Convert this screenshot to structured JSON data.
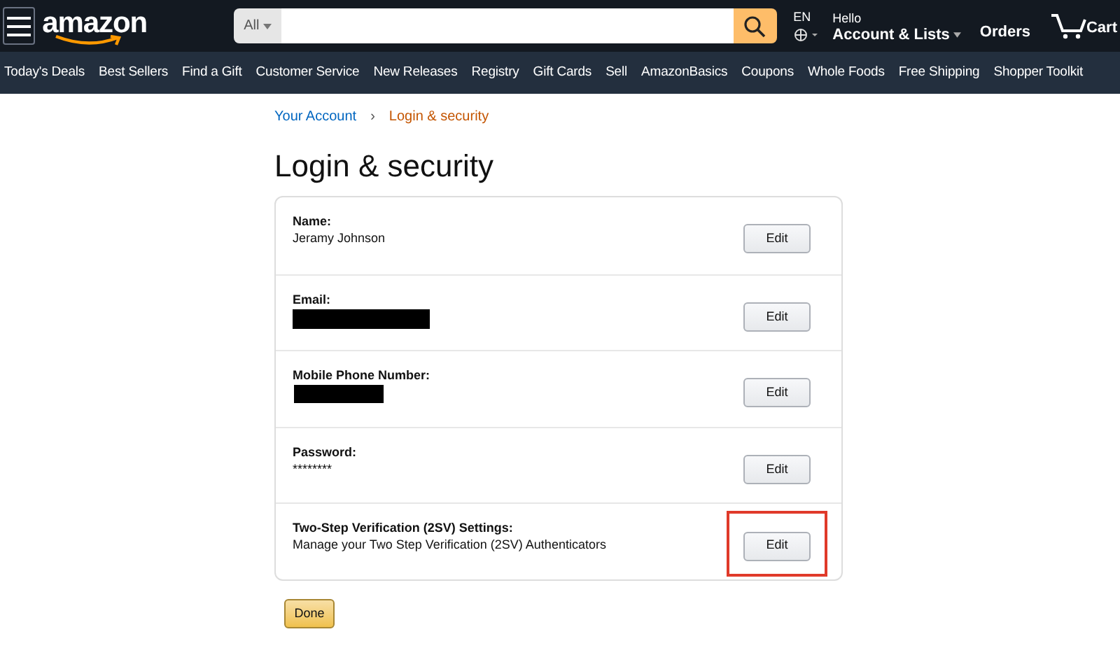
{
  "header": {
    "logo": "amazon",
    "search_category": "All",
    "language": "EN",
    "greeting": "Hello",
    "account": "Account & Lists",
    "orders": "Orders",
    "cart": "Cart"
  },
  "nav": [
    "Today's Deals",
    "Best Sellers",
    "Find a Gift",
    "Customer Service",
    "New Releases",
    "Registry",
    "Gift Cards",
    "Sell",
    "AmazonBasics",
    "Coupons",
    "Whole Foods",
    "Free Shipping",
    "Shopper Toolkit"
  ],
  "breadcrumb": [
    {
      "label": "Your Account",
      "selected": false
    },
    {
      "label": "Login & security",
      "selected": true
    }
  ],
  "breadcrumb_separator": "›",
  "title": "Login & security",
  "rows": [
    {
      "label": "Name:",
      "kind": "text",
      "value": "Jeramy Johnson",
      "button": "Edit",
      "highlighted": false
    },
    {
      "label": "Email:",
      "kind": "redacted_long",
      "button": "Edit",
      "highlighted": false
    },
    {
      "label": "Mobile Phone Number:",
      "kind": "redacted_short",
      "button": "Edit",
      "highlighted": false
    },
    {
      "label": "Password:",
      "kind": "text",
      "value": "********",
      "button": "Edit",
      "highlighted": false
    },
    {
      "label": "Two-Step Verification (2SV) Settings:",
      "kind": "text",
      "value": "Manage your Two Step Verification (2SV) Authenticators",
      "button": "Edit",
      "highlighted": true
    }
  ],
  "done_button": "Done"
}
